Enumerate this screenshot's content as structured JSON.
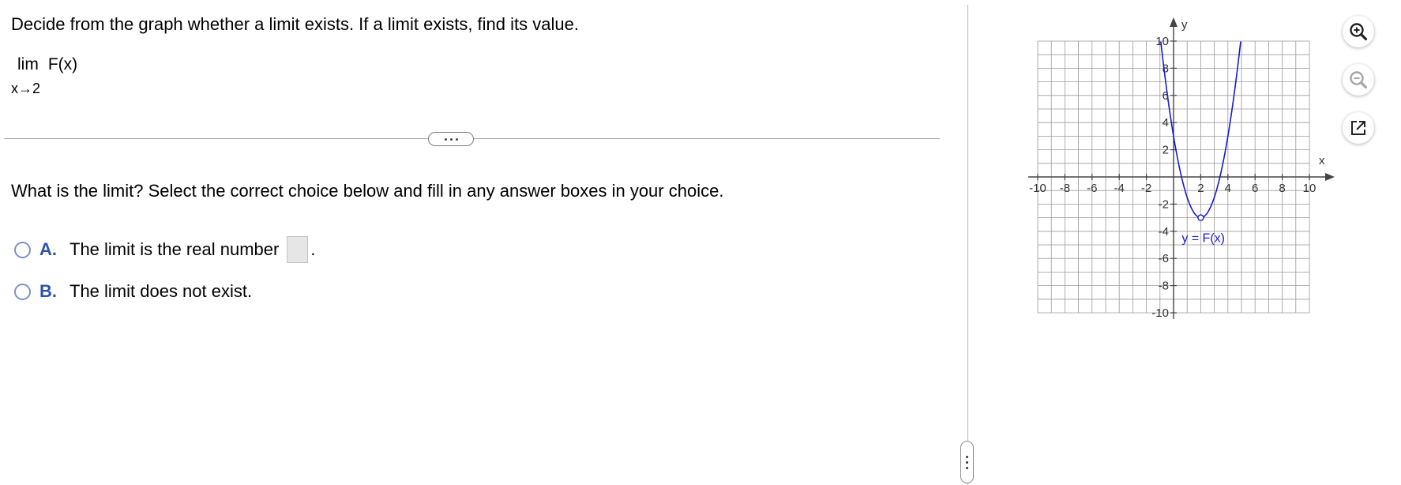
{
  "question": "Decide from the graph whether a limit exists. If a limit exists, find its value.",
  "limit": {
    "operator": "lim",
    "function": "F(x)",
    "subscript": "x→2"
  },
  "prompt": "What is the limit? Select the correct choice below and fill in any answer boxes in your choice.",
  "choices": [
    {
      "letter": "A.",
      "text": "The limit is the real number",
      "suffix": "."
    },
    {
      "letter": "B.",
      "text": "The limit does not exist."
    }
  ],
  "answer_box_value": "",
  "graph": {
    "x_axis_label": "x",
    "y_axis_label": "y",
    "curve_label": "y = F(x)",
    "x_ticks": [
      "-10",
      "-8",
      "-6",
      "-4",
      "-2",
      "2",
      "4",
      "6",
      "8",
      "10"
    ],
    "y_ticks": [
      "10",
      "8",
      "6",
      "4",
      "2",
      "-2",
      "-4",
      "-6",
      "-8",
      "-10"
    ],
    "x_range": [
      -10,
      10
    ],
    "y_range": [
      -10,
      10
    ],
    "grid_step": 1,
    "function": "F(x) = 1.5*(x - 2)^2 - 3",
    "open_circle": {
      "x": 2,
      "y": -3
    },
    "curve_color": "#1a1ad0"
  },
  "toolbar": {
    "zoom_in_icon": "zoom-in-icon",
    "zoom_out_icon": "zoom-out-icon",
    "popout_icon": "external-window-icon"
  }
}
